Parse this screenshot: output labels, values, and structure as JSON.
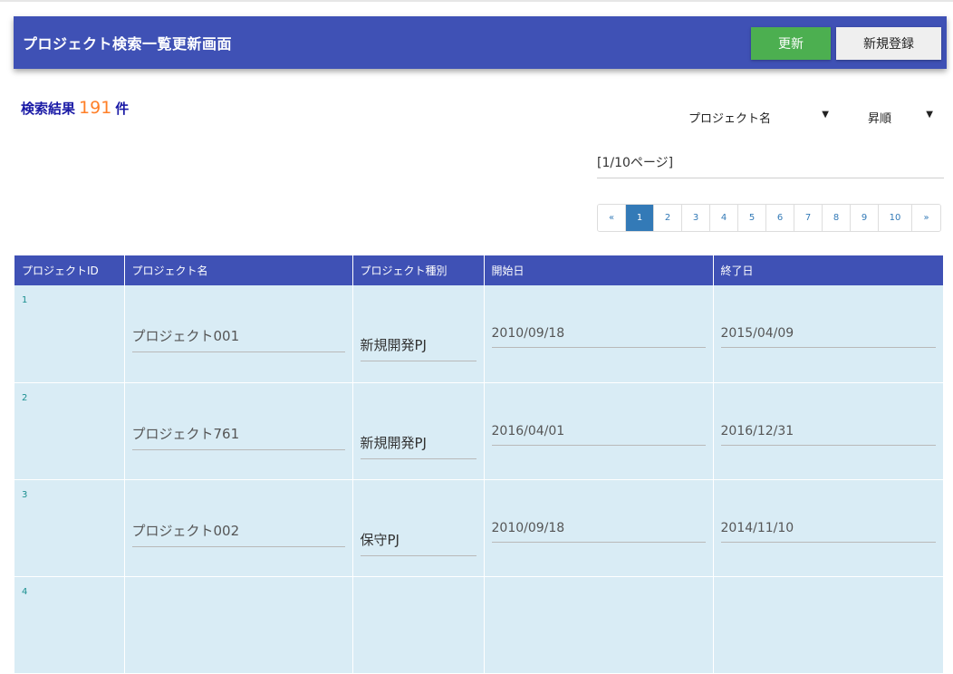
{
  "header": {
    "title": "プロジェクト検索一覧更新画面",
    "update_label": "更新",
    "new_label": "新規登録"
  },
  "result": {
    "prefix": "検索結果",
    "count": "191",
    "suffix": "件"
  },
  "sort": {
    "field": "プロジェクト名",
    "order": "昇順"
  },
  "page_info": "[1/10ページ]",
  "pagination": {
    "prev": "«",
    "pages": [
      "1",
      "2",
      "3",
      "4",
      "5",
      "6",
      "7",
      "8",
      "9",
      "10"
    ],
    "next": "»",
    "active": "1"
  },
  "table": {
    "columns": [
      "プロジェクトID",
      "プロジェクト名",
      "プロジェクト種別",
      "開始日",
      "終了日"
    ],
    "rows": [
      {
        "id": "1",
        "name": "プロジェクト001",
        "type": "新規開発PJ",
        "start": "2010/09/18",
        "end": "2015/04/09"
      },
      {
        "id": "2",
        "name": "プロジェクト761",
        "type": "新規開発PJ",
        "start": "2016/04/01",
        "end": "2016/12/31"
      },
      {
        "id": "3",
        "name": "プロジェクト002",
        "type": "保守PJ",
        "start": "2010/09/18",
        "end": "2014/11/10"
      },
      {
        "id": "4",
        "name": "",
        "type": "",
        "start": "",
        "end": ""
      }
    ]
  },
  "colors": {
    "header_bg": "#3f51b5",
    "update_button": "#4caf50",
    "row_bg": "#d9ecf5",
    "count_color": "#ff7f27",
    "result_color": "#1a1aa6",
    "active_page": "#337ab7"
  }
}
